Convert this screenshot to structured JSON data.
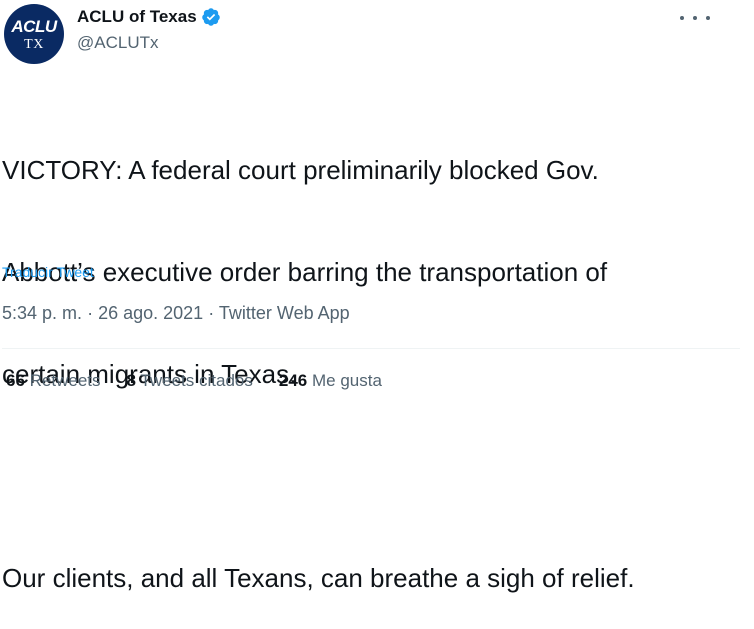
{
  "author": {
    "avatar_top": "ACLU",
    "avatar_bottom": "TX",
    "display_name": "ACLU of Texas",
    "handle": "@ACLUTx",
    "verified_color": "#1d9bf0",
    "avatar_color": "#0a2a63"
  },
  "tweet": {
    "text_line1": "VICTORY: A federal court preliminarily blocked Gov.",
    "text_line2": "Abbott’s executive order barring the transportation of",
    "text_line3": "certain migrants in Texas.",
    "text_line4": "Our clients, and all Texans, can breathe a sigh of relief.",
    "translate_label": "Traducir Tweet"
  },
  "meta": {
    "time": "5:34 p. m.",
    "separator": "·",
    "date": "26 ago. 2021",
    "source": "Twitter Web App"
  },
  "stats": {
    "retweets_count": "66",
    "retweets_label": "Retweets",
    "quotes_count": "8",
    "quotes_label": "Tweets citados",
    "likes_count": "246",
    "likes_label": "Me gusta"
  },
  "icons": {
    "more": "more-icon",
    "verified": "verified-badge-icon"
  }
}
